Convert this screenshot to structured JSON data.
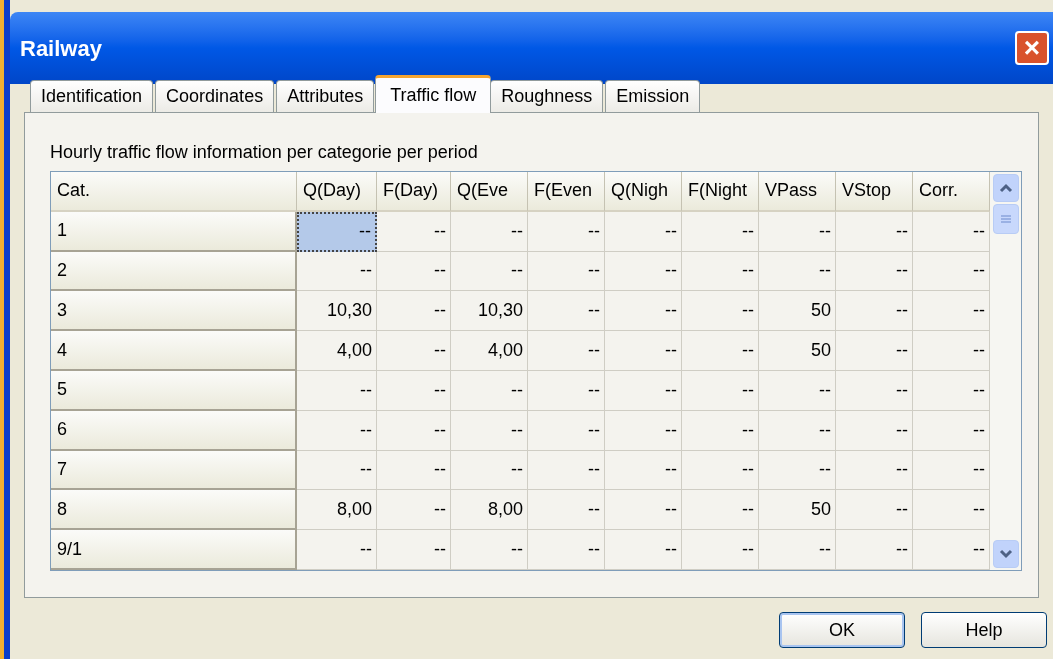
{
  "window": {
    "title": "Railway",
    "close": "×"
  },
  "tabs": [
    {
      "label": "Identification",
      "selected": false
    },
    {
      "label": "Coordinates",
      "selected": false
    },
    {
      "label": "Attributes",
      "selected": false
    },
    {
      "label": "Traffic flow",
      "selected": true
    },
    {
      "label": "Roughness",
      "selected": false
    },
    {
      "label": "Emission",
      "selected": false
    }
  ],
  "caption": "Hourly traffic flow information per categorie per period",
  "table": {
    "columns": [
      "Cat.",
      "Q(Day)",
      "F(Day)",
      "Q(Eve",
      "F(Even",
      "Q(Nigh",
      "F(Night",
      "VPass",
      "VStop",
      "Corr."
    ],
    "rows": [
      {
        "cat": "1",
        "cells": [
          {
            "text": "--",
            "selected": true
          },
          {
            "text": "--",
            "selected": false
          },
          {
            "text": "--",
            "selected": false
          },
          {
            "text": "--",
            "selected": false
          },
          {
            "text": "--",
            "selected": false
          },
          {
            "text": "--",
            "selected": false
          },
          {
            "text": "--",
            "selected": false
          },
          {
            "text": "--",
            "selected": false
          },
          {
            "text": "--",
            "selected": false
          }
        ]
      },
      {
        "cat": "2",
        "cells": [
          {
            "text": "--",
            "selected": false
          },
          {
            "text": "--",
            "selected": false
          },
          {
            "text": "--",
            "selected": false
          },
          {
            "text": "--",
            "selected": false
          },
          {
            "text": "--",
            "selected": false
          },
          {
            "text": "--",
            "selected": false
          },
          {
            "text": "--",
            "selected": false
          },
          {
            "text": "--",
            "selected": false
          },
          {
            "text": "--",
            "selected": false
          }
        ]
      },
      {
        "cat": "3",
        "cells": [
          {
            "text": "10,30",
            "selected": false
          },
          {
            "text": "--",
            "selected": false
          },
          {
            "text": "10,30",
            "selected": false
          },
          {
            "text": "--",
            "selected": false
          },
          {
            "text": "--",
            "selected": false
          },
          {
            "text": "--",
            "selected": false
          },
          {
            "text": "50",
            "selected": false
          },
          {
            "text": "--",
            "selected": false
          },
          {
            "text": "--",
            "selected": false
          }
        ]
      },
      {
        "cat": "4",
        "cells": [
          {
            "text": "4,00",
            "selected": false
          },
          {
            "text": "--",
            "selected": false
          },
          {
            "text": "4,00",
            "selected": false
          },
          {
            "text": "--",
            "selected": false
          },
          {
            "text": "--",
            "selected": false
          },
          {
            "text": "--",
            "selected": false
          },
          {
            "text": "50",
            "selected": false
          },
          {
            "text": "--",
            "selected": false
          },
          {
            "text": "--",
            "selected": false
          }
        ]
      },
      {
        "cat": "5",
        "cells": [
          {
            "text": "--",
            "selected": false
          },
          {
            "text": "--",
            "selected": false
          },
          {
            "text": "--",
            "selected": false
          },
          {
            "text": "--",
            "selected": false
          },
          {
            "text": "--",
            "selected": false
          },
          {
            "text": "--",
            "selected": false
          },
          {
            "text": "--",
            "selected": false
          },
          {
            "text": "--",
            "selected": false
          },
          {
            "text": "--",
            "selected": false
          }
        ]
      },
      {
        "cat": "6",
        "cells": [
          {
            "text": "--",
            "selected": false
          },
          {
            "text": "--",
            "selected": false
          },
          {
            "text": "--",
            "selected": false
          },
          {
            "text": "--",
            "selected": false
          },
          {
            "text": "--",
            "selected": false
          },
          {
            "text": "--",
            "selected": false
          },
          {
            "text": "--",
            "selected": false
          },
          {
            "text": "--",
            "selected": false
          },
          {
            "text": "--",
            "selected": false
          }
        ]
      },
      {
        "cat": "7",
        "cells": [
          {
            "text": "--",
            "selected": false
          },
          {
            "text": "--",
            "selected": false
          },
          {
            "text": "--",
            "selected": false
          },
          {
            "text": "--",
            "selected": false
          },
          {
            "text": "--",
            "selected": false
          },
          {
            "text": "--",
            "selected": false
          },
          {
            "text": "--",
            "selected": false
          },
          {
            "text": "--",
            "selected": false
          },
          {
            "text": "--",
            "selected": false
          }
        ]
      },
      {
        "cat": "8",
        "cells": [
          {
            "text": "8,00",
            "selected": false
          },
          {
            "text": "--",
            "selected": false
          },
          {
            "text": "8,00",
            "selected": false
          },
          {
            "text": "--",
            "selected": false
          },
          {
            "text": "--",
            "selected": false
          },
          {
            "text": "--",
            "selected": false
          },
          {
            "text": "50",
            "selected": false
          },
          {
            "text": "--",
            "selected": false
          },
          {
            "text": "--",
            "selected": false
          }
        ]
      },
      {
        "cat": "9/1",
        "cells": [
          {
            "text": "--",
            "selected": false
          },
          {
            "text": "--",
            "selected": false
          },
          {
            "text": "--",
            "selected": false
          },
          {
            "text": "--",
            "selected": false
          },
          {
            "text": "--",
            "selected": false
          },
          {
            "text": "--",
            "selected": false
          },
          {
            "text": "--",
            "selected": false
          },
          {
            "text": "--",
            "selected": false
          },
          {
            "text": "--",
            "selected": false
          }
        ]
      }
    ]
  },
  "buttons": [
    "OK",
    "Help"
  ]
}
